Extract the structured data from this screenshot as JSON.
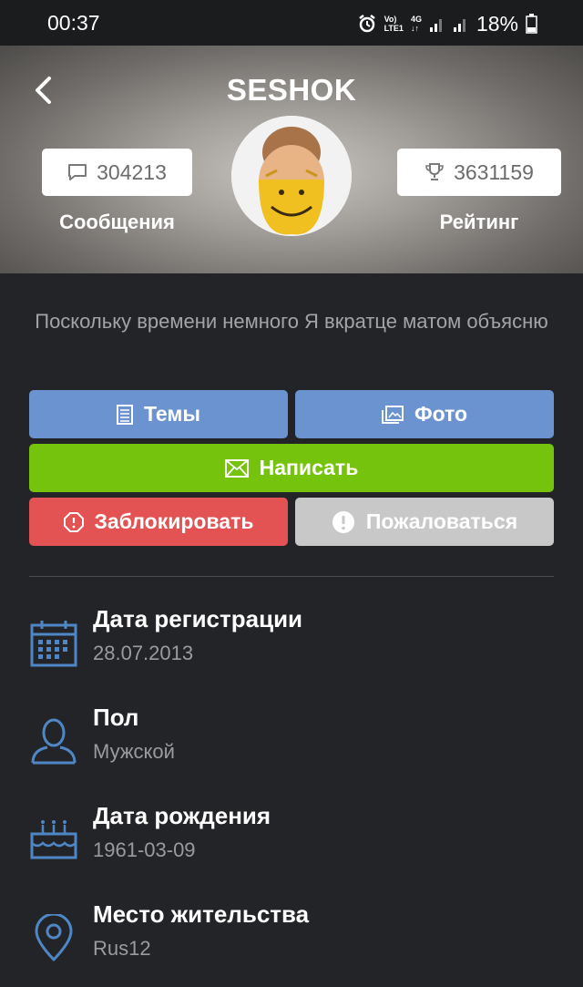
{
  "status_bar": {
    "time": "00:37",
    "network_top": "Vo)",
    "network_bottom": "LTE1",
    "net_type": "4G",
    "battery": "18%"
  },
  "header": {
    "title": "SESHOK",
    "messages_count": "304213",
    "messages_label": "Сообщения",
    "rating_count": "3631159",
    "rating_label": "Рейтинг"
  },
  "bio": "Поскольку времени немного  Я вкратце матом объясню",
  "actions": {
    "topics": "Темы",
    "photo": "Фото",
    "write": "Написать",
    "block": "Заблокировать",
    "report": "Пожаловаться"
  },
  "info": [
    {
      "title": "Дата регистрации",
      "value": "28.07.2013",
      "icon": "calendar-icon"
    },
    {
      "title": "Пол",
      "value": "Мужской",
      "icon": "person-icon"
    },
    {
      "title": "Дата рождения",
      "value": "1961-03-09",
      "icon": "cake-icon"
    },
    {
      "title": "Место жительства",
      "value": "Rus12",
      "icon": "location-pin-icon"
    }
  ],
  "colors": {
    "background": "#232427",
    "blue_button": "#6b93cf",
    "green_button": "#76c30d",
    "red_button": "#e35354",
    "grey_button": "#c8c8c8",
    "icon_blue": "#4f87c6"
  }
}
